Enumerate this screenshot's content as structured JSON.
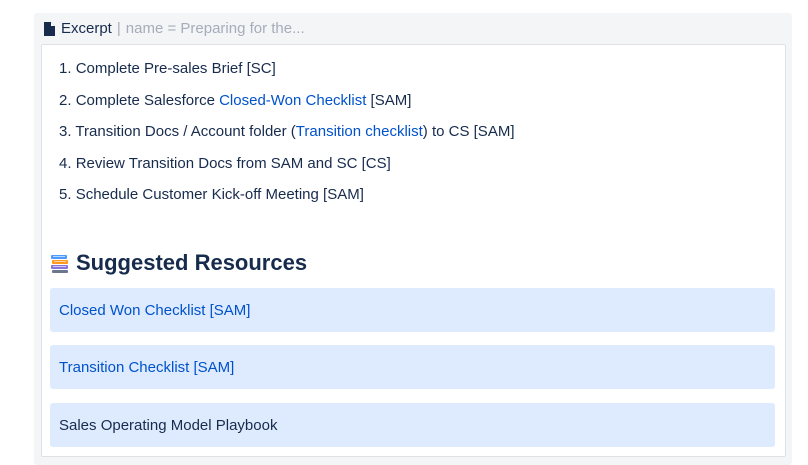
{
  "excerpt": {
    "title": "Excerpt",
    "separator": "|",
    "param": "name = Preparing for the..."
  },
  "steps": [
    {
      "num": "1.",
      "before": "Complete Pre-sales Brief [SC]",
      "link": "",
      "after": ""
    },
    {
      "num": "2.",
      "before": "Complete Salesforce ",
      "link": "Closed-Won Checklist",
      "after": " [SAM]"
    },
    {
      "num": "3.",
      "before": "Transition Docs / Account folder (",
      "link": "Transition checklist",
      "after": ") to CS [SAM]"
    },
    {
      "num": "4.",
      "before": "Review Transition Docs from SAM and SC [CS]",
      "link": "",
      "after": ""
    },
    {
      "num": "5.",
      "before": "Schedule Customer Kick-off Meeting [SAM]",
      "link": "",
      "after": ""
    }
  ],
  "resources": {
    "heading": "Suggested Resources",
    "items": [
      {
        "label": "Closed Won Checklist [SAM]"
      },
      {
        "label": "Transition Checklist [SAM]"
      },
      {
        "label": "Sales Operating Model Playbook"
      }
    ]
  },
  "colors": {
    "link": "#0052cc",
    "card_bg": "#deebff",
    "macro_bg": "#f4f5f7",
    "text": "#172b4d"
  },
  "icons": {
    "header_icon": "document-icon",
    "heading_icon": "books-icon"
  }
}
